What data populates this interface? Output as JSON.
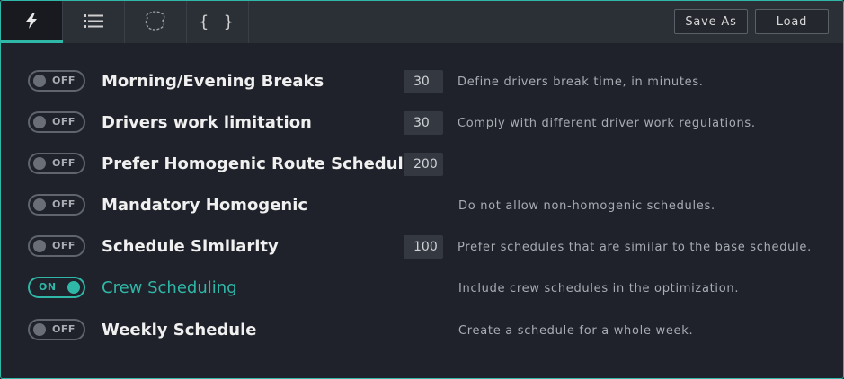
{
  "tabs": [
    {
      "icon": "lightning-icon"
    },
    {
      "icon": "list-icon"
    },
    {
      "icon": "blob-icon"
    },
    {
      "label": "{ }",
      "icon": "braces-icon"
    }
  ],
  "toolbar": {
    "save_as_label": "Save As",
    "load_label": "Load"
  },
  "toggle_labels": {
    "on": "ON",
    "off": "OFF"
  },
  "accent_color": "#2fb7a8",
  "settings": [
    {
      "title": "Morning/Evening Breaks",
      "value": "30",
      "description": "Define drivers break time, in minutes.",
      "enabled": false
    },
    {
      "title": "Drivers work limitation",
      "value": "30",
      "description": "Comply with different driver work regulations.",
      "enabled": false
    },
    {
      "title": "Prefer Homogenic Route Schedule",
      "value": "200",
      "description": "",
      "enabled": false
    },
    {
      "title": "Mandatory Homogenic",
      "value": "",
      "description": "Do not allow non-homogenic schedules.",
      "enabled": false
    },
    {
      "title": "Schedule Similarity",
      "value": "100",
      "description": "Prefer schedules that are similar to the base schedule.",
      "enabled": false
    },
    {
      "title": "Crew Scheduling",
      "value": "",
      "description": "Include crew schedules in the optimization.",
      "enabled": true
    },
    {
      "title": "Weekly Schedule",
      "value": "",
      "description": "Create a schedule for a whole week.",
      "enabled": false
    }
  ]
}
